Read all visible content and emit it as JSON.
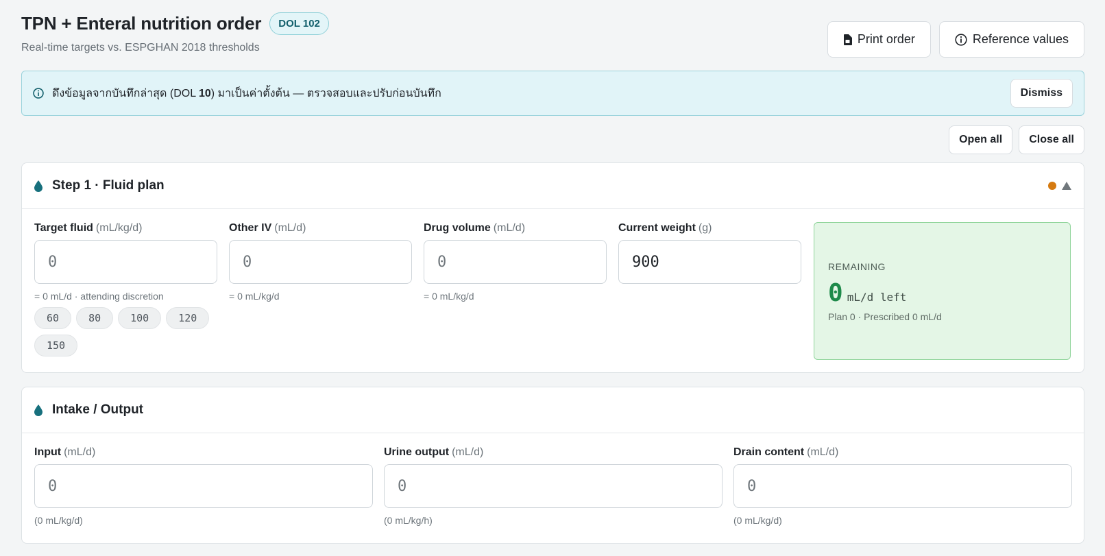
{
  "header": {
    "title": "TPN + Enteral nutrition order",
    "dol_badge": "DOL 102",
    "subtitle": "Real-time targets vs. ESPGHAN 2018 thresholds",
    "print_label": "Print order",
    "reference_label": "Reference values"
  },
  "banner": {
    "text_before": "ดึงข้อมูลจากบันทึกล่าสุด (DOL ",
    "text_bold": "10",
    "text_after": ") มาเป็นค่าตั้งต้น — ตรวจสอบและปรับก่อนบันทึก",
    "dismiss_label": "Dismiss"
  },
  "bulk": {
    "open_all": "Open all",
    "close_all": "Close all"
  },
  "fluid_plan": {
    "title": "Step 1 · Fluid plan",
    "status_color": "#d57a10",
    "fields": [
      {
        "label": "Target fluid",
        "unit": "(mL/kg/d)",
        "value": "",
        "placeholder": "0",
        "hint": "= 0 mL/d · attending discretion"
      },
      {
        "label": "Other IV",
        "unit": "(mL/d)",
        "value": "",
        "placeholder": "0",
        "hint": "= 0 mL/kg/d"
      },
      {
        "label": "Drug volume",
        "unit": "(mL/d)",
        "value": "",
        "placeholder": "0",
        "hint": "= 0 mL/kg/d"
      },
      {
        "label": "Current weight",
        "unit": "(g)",
        "value": "900",
        "placeholder": "",
        "hint": ""
      }
    ],
    "presets": [
      "60",
      "80",
      "100",
      "120",
      "150"
    ],
    "remaining": {
      "label": "REMAINING",
      "value": "0",
      "unit": "mL/d left",
      "sub": "Plan 0 · Prescribed 0 mL/d"
    }
  },
  "intake_output": {
    "title": "Intake / Output",
    "fields": [
      {
        "label": "Input",
        "unit": "(mL/d)",
        "value": "",
        "placeholder": "0",
        "hint": "(0 mL/kg/d)"
      },
      {
        "label": "Urine output",
        "unit": "(mL/d)",
        "value": "",
        "placeholder": "0",
        "hint": "(0 mL/kg/h)"
      },
      {
        "label": "Drain content",
        "unit": "(mL/d)",
        "value": "",
        "placeholder": "0",
        "hint": "(0 mL/kg/d)"
      }
    ]
  },
  "icons": {
    "print": "print-icon",
    "info": "info-icon",
    "drop": "drop-icon",
    "collapse": "triangle-up-icon"
  },
  "colors": {
    "accent": "#125f6b",
    "banner_bg": "#e1f4f8",
    "remaining_bg": "#e4f6e6",
    "remaining_value": "#1e8a4a"
  }
}
